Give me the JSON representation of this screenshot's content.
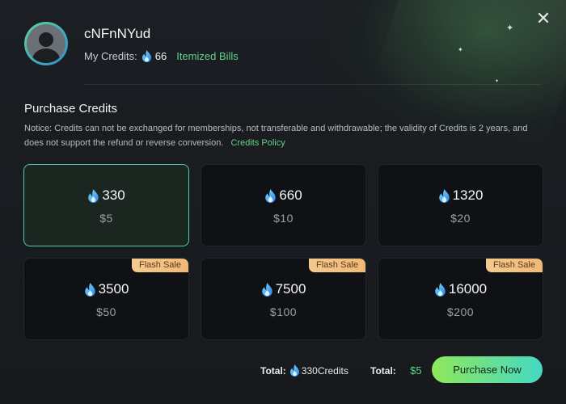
{
  "header": {
    "username": "cNFnNYud",
    "credits_label": "My Credits:",
    "credits_count": "66",
    "bills_link": "Itemized Bills"
  },
  "purchase": {
    "title": "Purchase Credits",
    "notice": "Notice: Credits can not be exchanged for memberships, not transferable and withdrawable; the validity of Credits is 2 years, and does not support the refund or reverse conversion.",
    "policy_link": "Credits Policy"
  },
  "packages": [
    {
      "credits": "330",
      "price": "$5",
      "badge": "",
      "selected": true
    },
    {
      "credits": "660",
      "price": "$10",
      "badge": "",
      "selected": false
    },
    {
      "credits": "1320",
      "price": "$20",
      "badge": "",
      "selected": false
    },
    {
      "credits": "3500",
      "price": "$50",
      "badge": "Flash Sale",
      "selected": false
    },
    {
      "credits": "7500",
      "price": "$100",
      "badge": "Flash Sale",
      "selected": false
    },
    {
      "credits": "16000",
      "price": "$200",
      "badge": "Flash Sale",
      "selected": false
    }
  ],
  "footer": {
    "total_label": "Total:",
    "total_credits": "330",
    "credits_unit": "Credits",
    "total_price_label": "Total:",
    "total_price": "$5",
    "purchase_button": "Purchase Now"
  },
  "icons": {
    "close": "close-icon",
    "currency": "flame-icon",
    "avatar": "user-avatar-icon"
  },
  "colors": {
    "accent_green": "#5fd38b",
    "selected_border": "#4ecfa8",
    "badge_bg": "#f0b877",
    "button_gradient_start": "#8fe85a",
    "button_gradient_end": "#45d8c4"
  }
}
